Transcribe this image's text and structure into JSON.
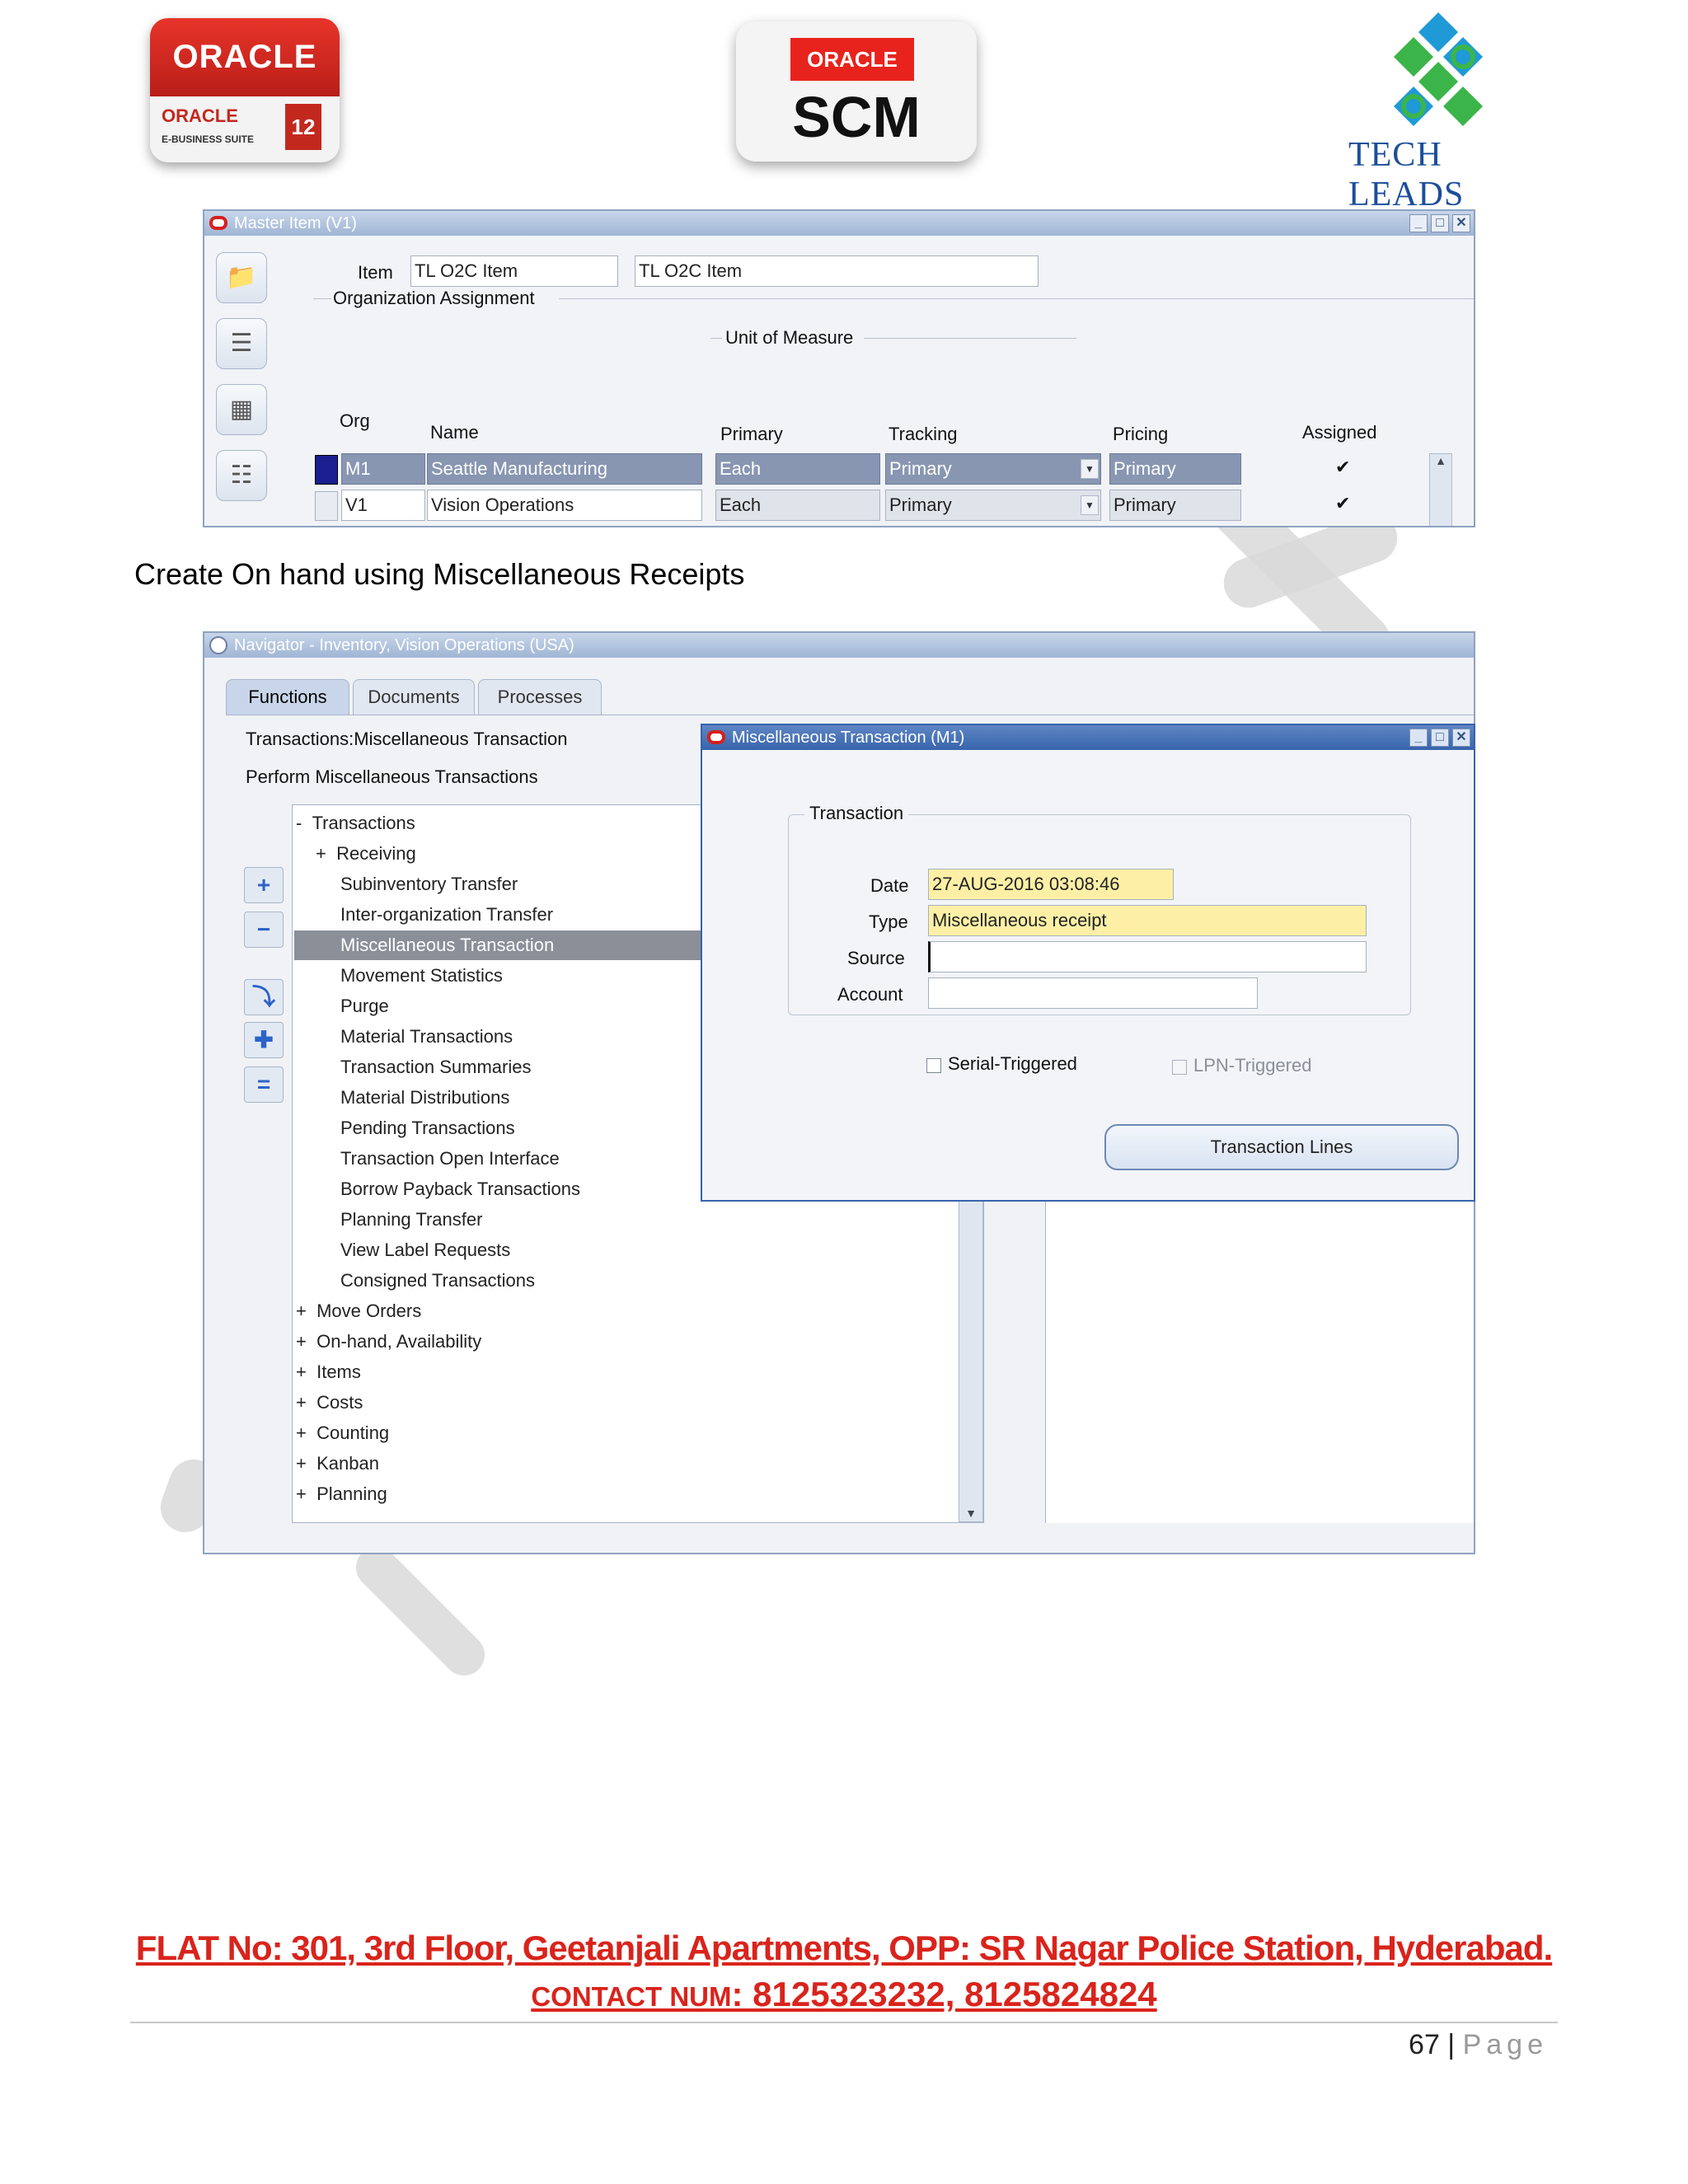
{
  "logos": {
    "oracle_ebs": {
      "brand": "ORACLE",
      "sub_brand": "ORACLE",
      "suite": "E-BUSINESS SUITE",
      "version": "12"
    },
    "scm": {
      "brand": "ORACLE",
      "product": "SCM"
    },
    "tech_leads": {
      "name": "TECH LEADS"
    }
  },
  "master_item": {
    "title": "Master Item (V1)",
    "item_label": "Item",
    "item_value": "TL O2C Item",
    "item_description": "TL O2C Item",
    "org_assignment_label": "Organization Assignment",
    "uom_label": "Unit of Measure",
    "columns": {
      "org": "Org",
      "name": "Name",
      "primary": "Primary",
      "tracking": "Tracking",
      "pricing": "Pricing",
      "assigned": "Assigned"
    },
    "rows": [
      {
        "org": "M1",
        "name": "Seattle Manufacturing",
        "primary": "Each",
        "tracking": "Primary",
        "pricing": "Primary",
        "assigned": "✔"
      },
      {
        "org": "V1",
        "name": "Vision Operations",
        "primary": "Each",
        "tracking": "Primary",
        "pricing": "Primary",
        "assigned": "✔"
      }
    ]
  },
  "heading": "Create On hand using Miscellaneous Receipts",
  "navigator": {
    "title": "Navigator - Inventory, Vision Operations (USA)",
    "tabs": [
      "Functions",
      "Documents",
      "Processes"
    ],
    "path_line1": "Transactions:Miscellaneous Transaction",
    "path_line2": "Perform Miscellaneous Transactions",
    "tree": [
      {
        "prefix": "-",
        "label": "Transactions"
      },
      {
        "prefix": "+",
        "label": "Receiving"
      },
      {
        "prefix": "",
        "label": "Subinventory Transfer"
      },
      {
        "prefix": "",
        "label": "Inter-organization Transfer"
      },
      {
        "prefix": "",
        "label": "Miscellaneous Transaction"
      },
      {
        "prefix": "",
        "label": "Movement Statistics"
      },
      {
        "prefix": "",
        "label": "Purge"
      },
      {
        "prefix": "",
        "label": "Material Transactions"
      },
      {
        "prefix": "",
        "label": "Transaction Summaries"
      },
      {
        "prefix": "",
        "label": "Material Distributions"
      },
      {
        "prefix": "",
        "label": "Pending Transactions"
      },
      {
        "prefix": "",
        "label": "Transaction Open Interface"
      },
      {
        "prefix": "",
        "label": "Borrow Payback Transactions"
      },
      {
        "prefix": "",
        "label": "Planning Transfer"
      },
      {
        "prefix": "",
        "label": "View Label Requests"
      },
      {
        "prefix": "",
        "label": "Consigned Transactions"
      },
      {
        "prefix": "+",
        "label": "Move Orders"
      },
      {
        "prefix": "+",
        "label": "On-hand, Availability"
      },
      {
        "prefix": "+",
        "label": "Items"
      },
      {
        "prefix": "+",
        "label": "Costs"
      },
      {
        "prefix": "+",
        "label": "Counting"
      },
      {
        "prefix": "+",
        "label": "Kanban"
      },
      {
        "prefix": "+",
        "label": "Planning"
      }
    ]
  },
  "misc_transaction": {
    "title": "Miscellaneous Transaction (M1)",
    "group_label": "Transaction",
    "date_label": "Date",
    "date_value": "27-AUG-2016 03:08:46",
    "type_label": "Type",
    "type_value": "Miscellaneous receipt",
    "source_label": "Source",
    "source_value": "",
    "account_label": "Account",
    "account_value": "",
    "serial_triggered": "Serial-Triggered",
    "lpn_triggered": "LPN-Triggered",
    "transaction_lines_button": "Transaction Lines"
  },
  "footer": {
    "address": "FLAT No: 301, 3rd Floor, Geetanjali Apartments, OPP: SR Nagar Police Station, Hyderabad.",
    "contact_label": "CONTACT NUM",
    "contact_numbers": ": 8125323232, 8125824824",
    "page_number": "67",
    "page_separator": " | ",
    "page_word": "Page"
  },
  "colors": {
    "accent_red": "#d9241c",
    "oracle_blue": "#3764ad",
    "highlight_yellow": "#fdf0a6"
  }
}
